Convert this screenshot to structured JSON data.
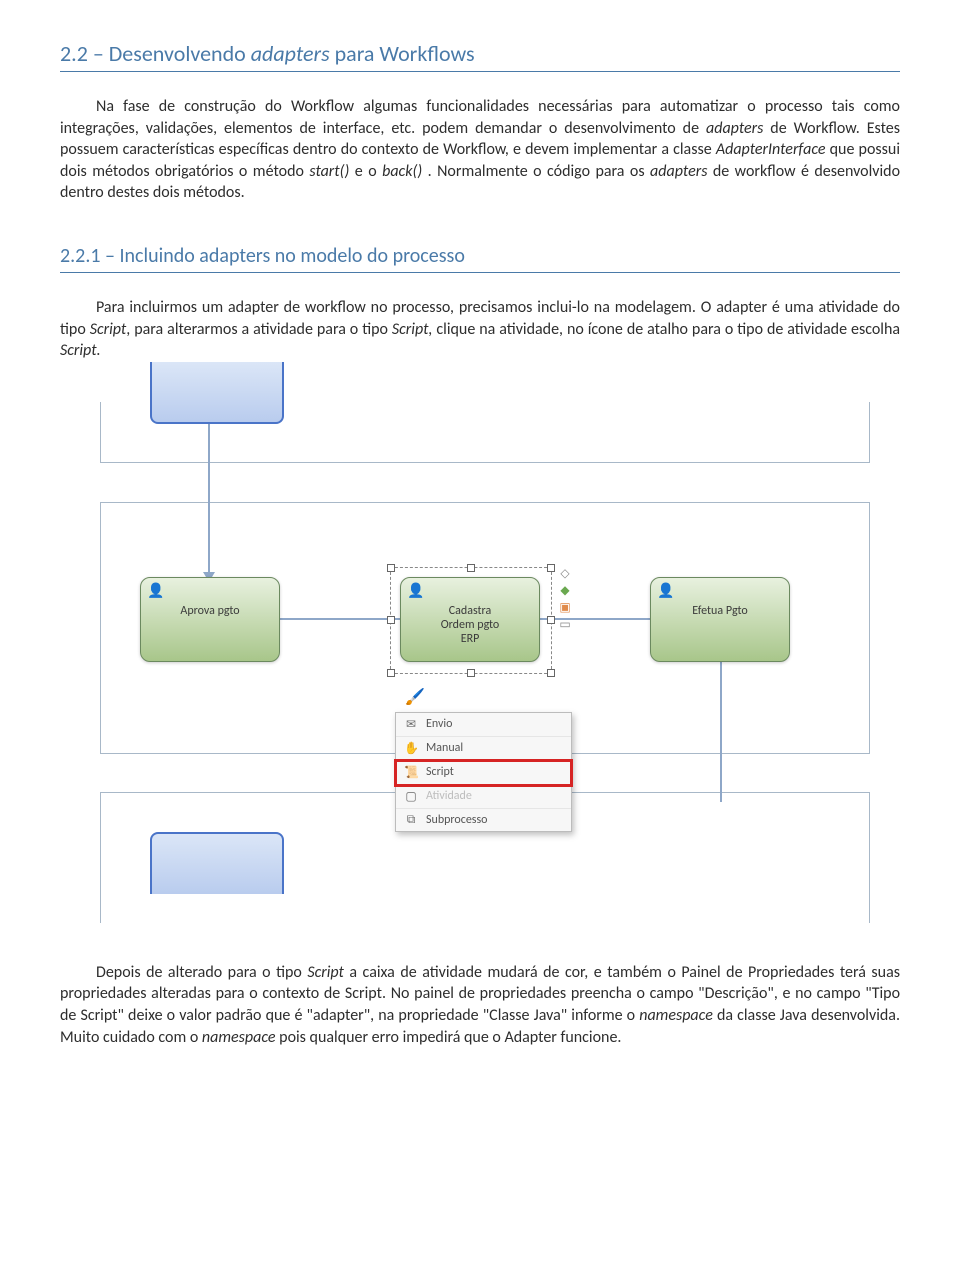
{
  "headings": {
    "h1_prefix": "2.2 – Desenvolvendo ",
    "h1_italic": "adapters",
    "h1_suffix": " para Workflows",
    "h2": "2.2.1 – Incluindo adapters no modelo do processo"
  },
  "paragraphs": {
    "p1_a": "Na fase de construção do Workflow algumas funcionalidades necessárias para automatizar o processo tais como integrações, validações, elementos de interface, etc. podem demandar o desenvolvimento de ",
    "p1_b": "adapters",
    "p1_c": " de Workflow.  Estes possuem características específicas dentro do contexto de Workflow, e devem implementar a classe ",
    "p1_d": "AdapterInterface",
    "p1_e": " que possui dois métodos obrigatórios o método ",
    "p1_f": "start()",
    "p1_g": "  e o ",
    "p1_h": "back()",
    "p1_i": " . Normalmente o código para os ",
    "p1_j": "adapters",
    "p1_k": " de workflow é desenvolvido dentro destes dois métodos.",
    "p2_a": "Para incluirmos um adapter de workflow no processo, precisamos inclui-lo na modelagem.  O adapter é uma atividade do tipo ",
    "p2_b": "Script",
    "p2_c": ", para alterarmos a atividade para o tipo ",
    "p2_d": "Script,",
    "p2_e": " clique na atividade, no ícone de atalho para o tipo de atividade escolha ",
    "p2_f": "Script.",
    "p3_a": "Depois de alterado para o tipo ",
    "p3_b": "Script",
    "p3_c": " a caixa de atividade mudará de cor, e também o Painel de Propriedades terá suas propriedades alteradas para o contexto de Script.  No painel de propriedades preencha o campo \"Descrição\", e no campo \"Tipo de Script\" deixe o valor padrão que é \"adapter\", na propriedade \"Classe Java\" informe o ",
    "p3_d": "namespace",
    "p3_e": " da classe Java desenvolvida. Muito cuidado com o ",
    "p3_f": "namespace",
    "p3_g": " pois qualquer erro impedirá que o Adapter funcione."
  },
  "diagram": {
    "activities": {
      "a1": "Aprova pgto",
      "a2_l1": "Cadastra",
      "a2_l2": "Ordem pgto",
      "a2_l3": "ERP",
      "a3": "Efetua Pgto"
    },
    "menu": {
      "items": [
        {
          "icon": "✉",
          "label": "Envio"
        },
        {
          "icon": "✋",
          "label": "Manual"
        },
        {
          "icon": "📜",
          "label": "Script",
          "highlight": true
        },
        {
          "icon": "▢",
          "label": "Atividade",
          "disabled": true
        },
        {
          "icon": "⧉",
          "label": "Subprocesso"
        }
      ]
    }
  }
}
